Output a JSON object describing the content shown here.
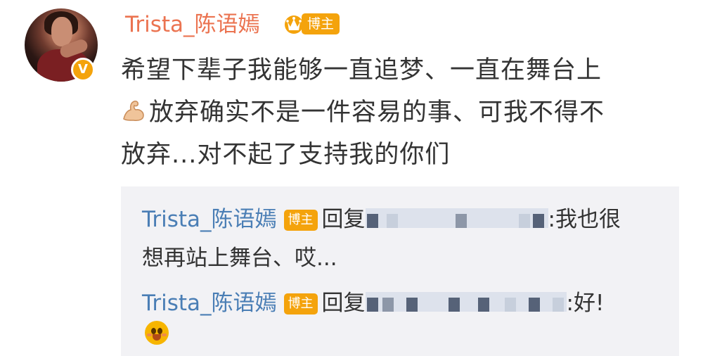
{
  "post": {
    "username": "Trista_陈语嫣",
    "role_badge": "博主",
    "verified_mark": "V",
    "text_lines": [
      "希望下辈子我能够一直追梦、一直在舞台上",
      "放弃确实不是一件容易的事、可我不得不",
      "放弃...对不起了支持我的你们"
    ],
    "icons": [
      "avatar",
      "verified-badge-icon",
      "crown-icon",
      "flexed-biceps-icon"
    ]
  },
  "replies": [
    {
      "username": "Trista_陈语嫣",
      "role_badge": "博主",
      "reply_label": "回复",
      "text_after_mention": ":我也很",
      "text_continued": "想再站上舞台、哎..."
    },
    {
      "username": "Trista_陈语嫣",
      "role_badge": "博主",
      "reply_label": "回复",
      "text_after_mention": ":好!",
      "emoji": "smiling-face-with-blush-icon"
    }
  ],
  "colors": {
    "username": "#eb7350",
    "badge": "#f4a30c",
    "reply_username": "#4a7eb5",
    "reply_background": "#f2f2f5",
    "text": "#333333"
  }
}
